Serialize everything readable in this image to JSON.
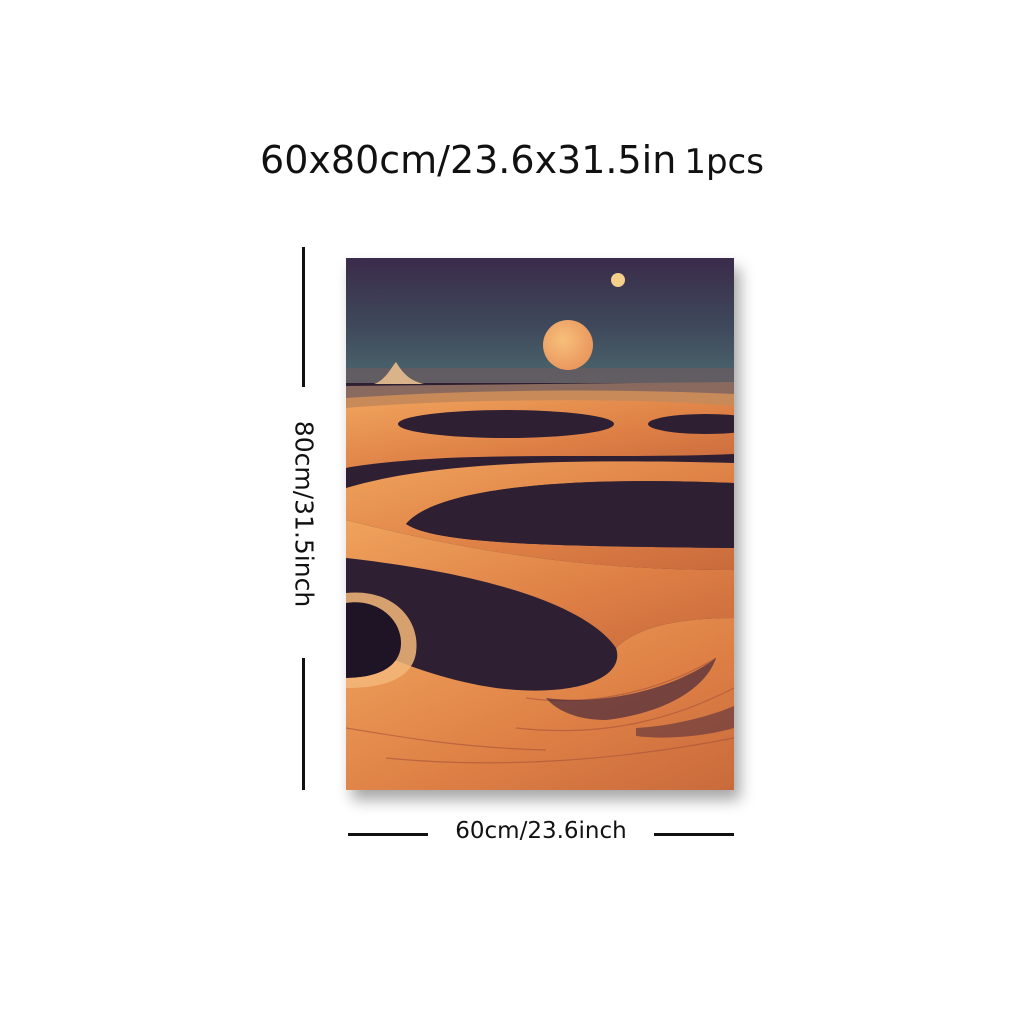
{
  "headline": {
    "size_text": "60x80cm/23.6x31.5in",
    "quantity_text": "1pcs"
  },
  "dimensions": {
    "height_label": "80cm/31.5inch",
    "width_label": "60cm/23.6inch"
  },
  "artwork": {
    "subject": "surreal desert landscape with sun and moon",
    "colors": {
      "sky_top": "#3a2b4a",
      "sky_horizon": "#4d6b70",
      "sand": "#e0894a",
      "shadow": "#2e1f33",
      "sun": "#f2a865"
    }
  }
}
